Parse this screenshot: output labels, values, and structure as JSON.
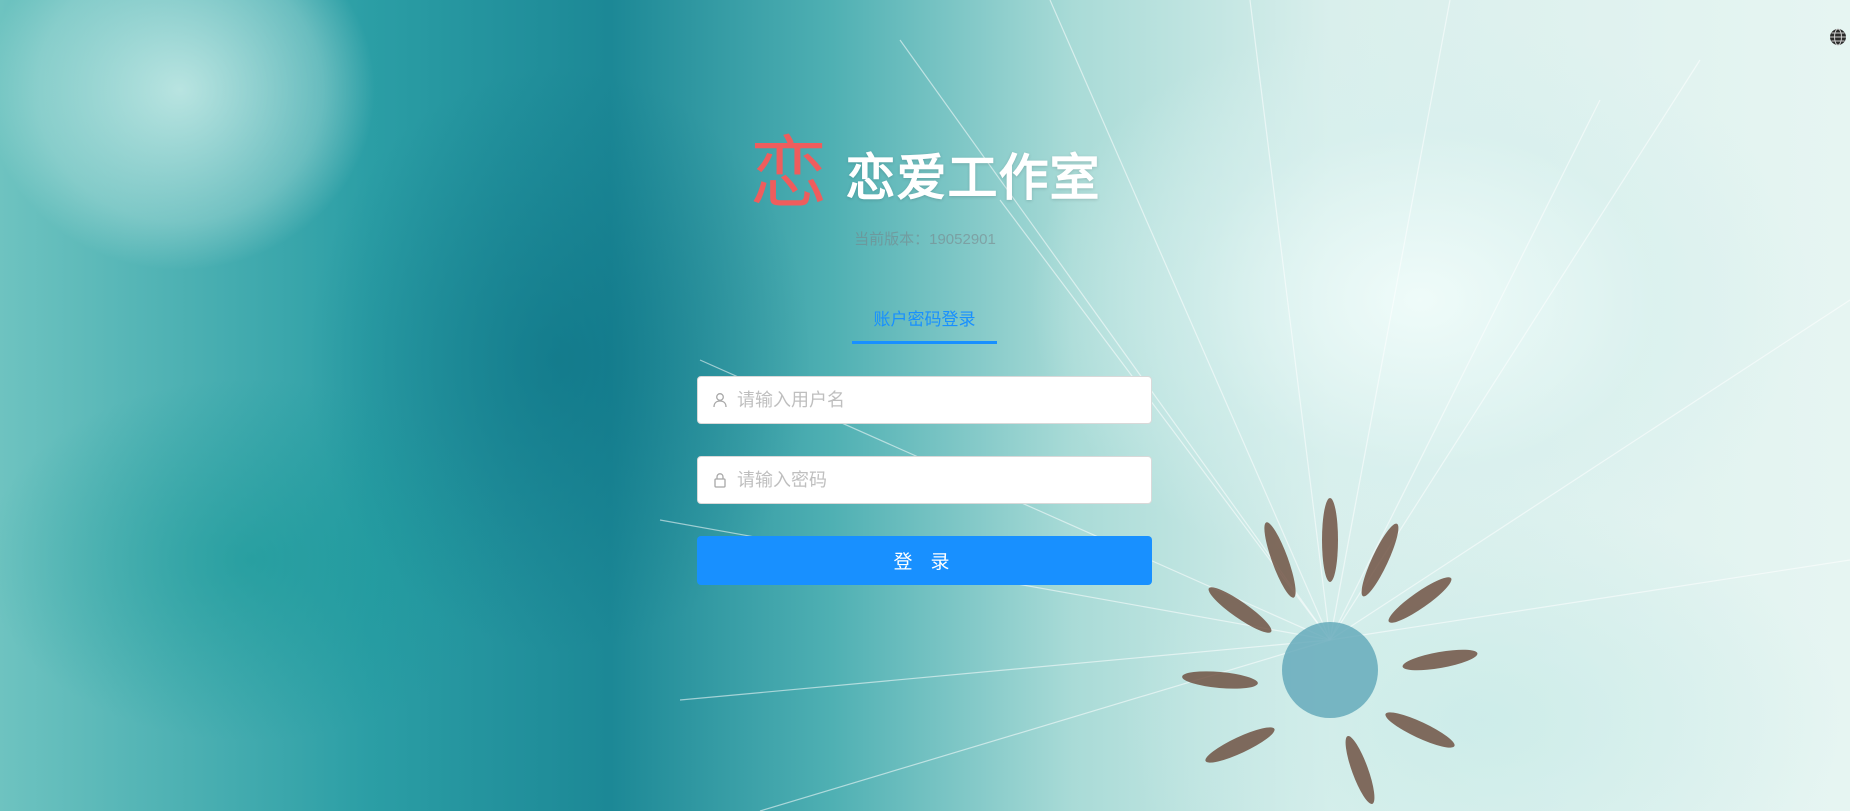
{
  "header": {
    "logo_char": "恋",
    "title": "恋爱工作室",
    "version": "当前版本：19052901"
  },
  "login": {
    "tab_label": "账户密码登录",
    "username_placeholder": "请输入用户名",
    "password_placeholder": "请输入密码",
    "submit_label": "登 录"
  },
  "icons": {
    "username": "user-icon",
    "password": "lock-icon",
    "corner": "globe-icon"
  },
  "colors": {
    "accent": "#1890ff",
    "logo": "#ee5d5d"
  }
}
